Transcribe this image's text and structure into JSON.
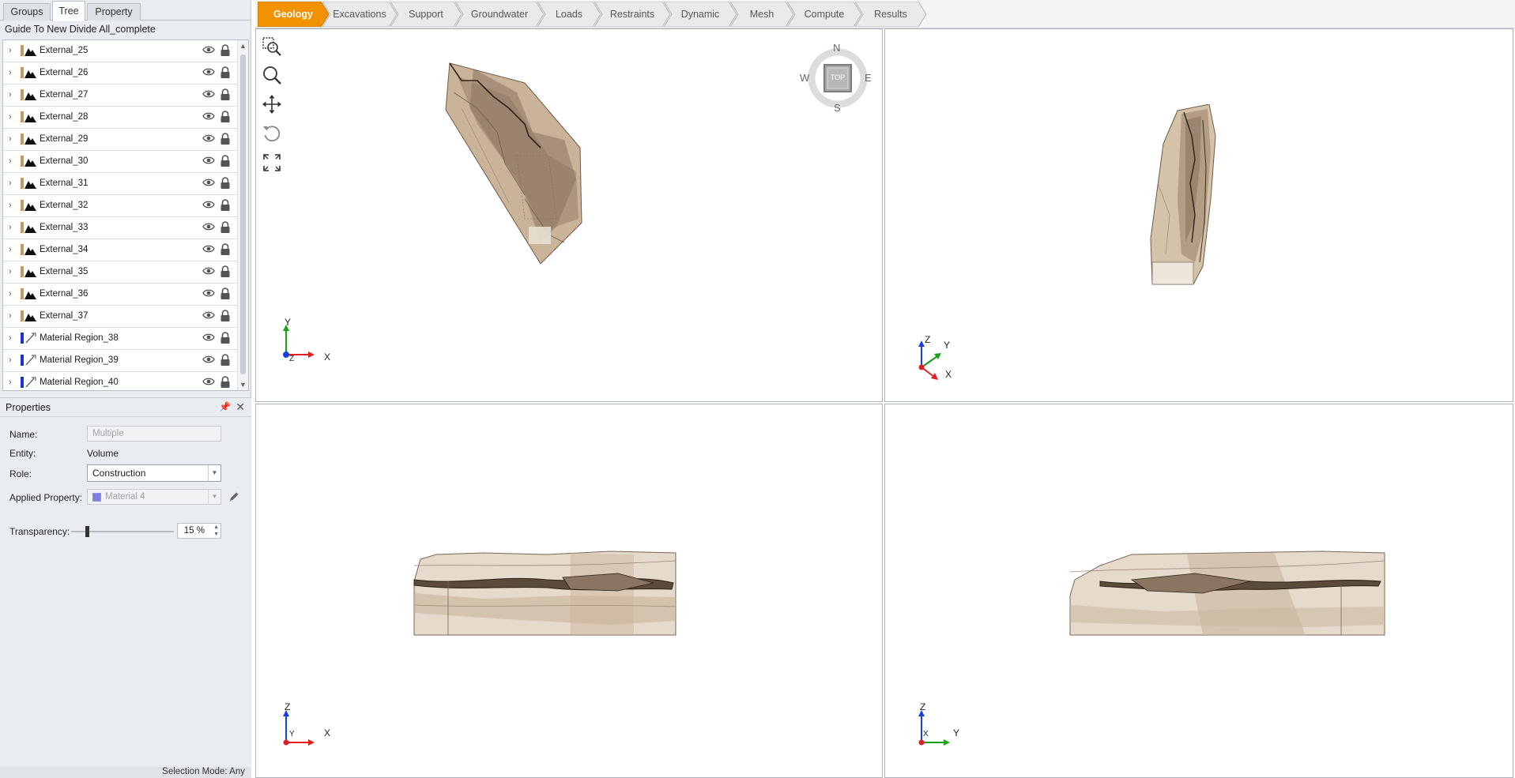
{
  "left_panel": {
    "tabs": [
      "Groups",
      "Tree",
      "Property"
    ],
    "active_tab": "Tree",
    "project_title": "Guide To New Divide All_complete",
    "tree_items": [
      {
        "label": "External_25",
        "type": "external"
      },
      {
        "label": "External_26",
        "type": "external"
      },
      {
        "label": "External_27",
        "type": "external"
      },
      {
        "label": "External_28",
        "type": "external"
      },
      {
        "label": "External_29",
        "type": "external"
      },
      {
        "label": "External_30",
        "type": "external"
      },
      {
        "label": "External_31",
        "type": "external"
      },
      {
        "label": "External_32",
        "type": "external"
      },
      {
        "label": "External_33",
        "type": "external"
      },
      {
        "label": "External_34",
        "type": "external"
      },
      {
        "label": "External_35",
        "type": "external"
      },
      {
        "label": "External_36",
        "type": "external"
      },
      {
        "label": "External_37",
        "type": "external"
      },
      {
        "label": "Material Region_38",
        "type": "material-region"
      },
      {
        "label": "Material Region_39",
        "type": "material-region"
      },
      {
        "label": "Material Region_40",
        "type": "material-region"
      }
    ]
  },
  "properties": {
    "title": "Properties",
    "name_label": "Name:",
    "name_value": "Multiple",
    "entity_label": "Entity:",
    "entity_value": "Volume",
    "role_label": "Role:",
    "role_value": "Construction",
    "applied_label": "Applied Property:",
    "applied_value": "Material 4",
    "applied_color": "#7b80e0",
    "transparency_label": "Transparency:",
    "transparency_value": "15 %",
    "transparency_fraction": 0.15
  },
  "status_bar": {
    "text": "Selection Mode: Any"
  },
  "workflow": {
    "steps": [
      "Geology",
      "Excavations",
      "Support",
      "Groundwater",
      "Loads",
      "Restraints",
      "Dynamic",
      "Mesh",
      "Compute",
      "Results"
    ],
    "active": "Geology",
    "active_color": "#f39200"
  },
  "viewports": {
    "top_view": {
      "x_axis": "X",
      "y_axis": "Y",
      "z_axis": "Z",
      "compass": {
        "n": "N",
        "s": "S",
        "e": "E",
        "w": "W",
        "center": "TOP"
      }
    },
    "perspective": {
      "z_axis": "Z",
      "y_axis": "Y",
      "x_axis": "X"
    },
    "front": {
      "z_axis": "Z",
      "y_axis": "Y",
      "x_axis": "X"
    },
    "side": {
      "z_axis": "Z",
      "x_axis": "X",
      "y_axis": "Y"
    }
  },
  "colors": {
    "model_fill": "#c9b49a",
    "model_dark": "#8a7560",
    "model_edge": "#5c4a3a",
    "axis_x": "#e02020",
    "axis_y": "#18a018",
    "axis_z": "#1a3fe0"
  }
}
